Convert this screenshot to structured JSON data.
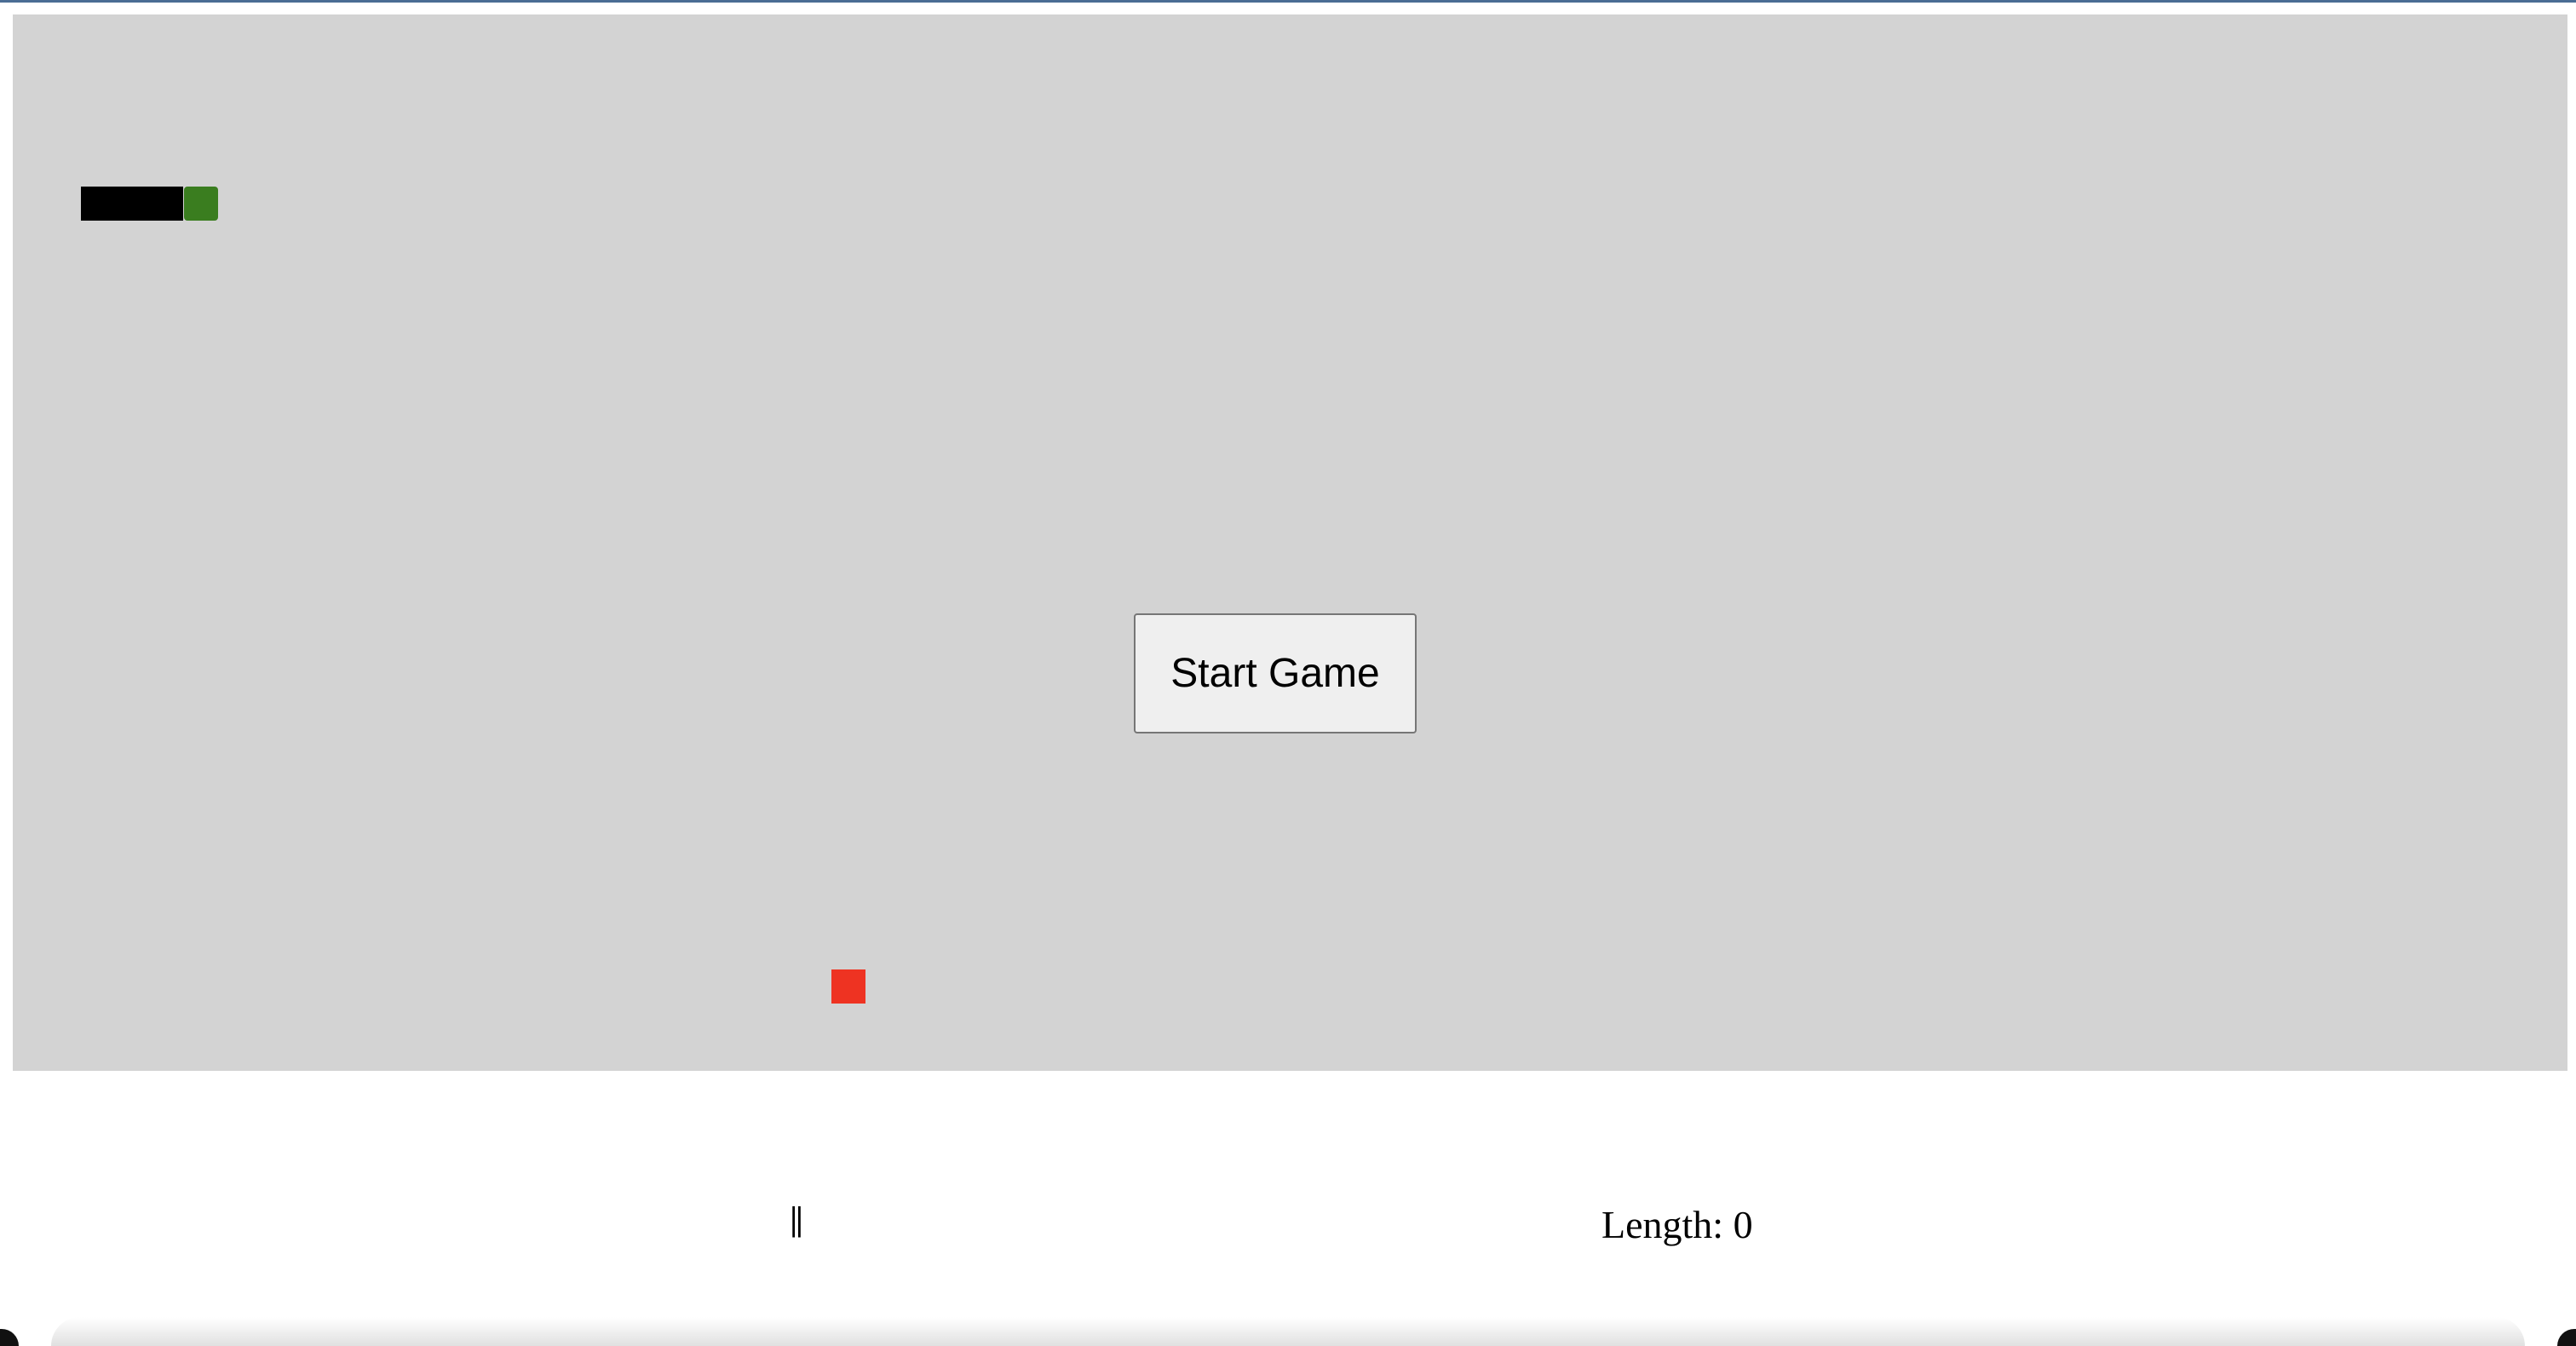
{
  "game": {
    "start_button_label": "Start Game",
    "pause_label": "||",
    "length_label": "Length: 0"
  },
  "colors": {
    "board": "#d3d3d3",
    "snake_body": "#000000",
    "snake_head": "#3a7d1f",
    "food": "#ee3322"
  },
  "icons": {
    "pause": "pause-icon"
  }
}
